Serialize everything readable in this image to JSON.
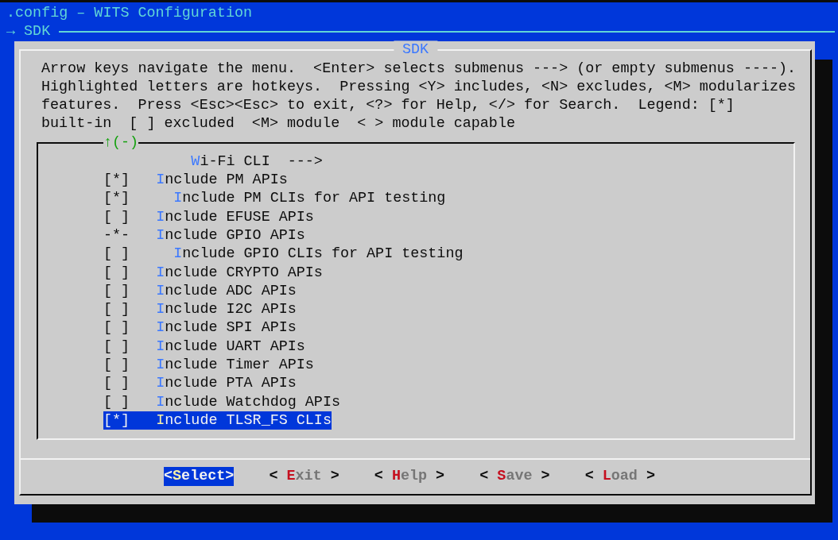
{
  "header": {
    "title": ".config – WITS Configuration",
    "breadcrumb": "→ SDK"
  },
  "dialog": {
    "title": "SDK",
    "help_text": "Arrow keys navigate the menu.  <Enter> selects submenus ---> (or empty submenus ----).\nHighlighted letters are hotkeys.  Pressing <Y> includes, <N> excludes, <M> modularizes\nfeatures.  Press <Esc><Esc> to exit, <?> for Help, </> for Search.  Legend: [*]\nbuilt-in  [ ] excluded  <M> module  < > module capable",
    "menu": {
      "scroll_indicator": "↑(-)",
      "items": [
        {
          "kind": "menu",
          "label": "Wi-Fi CLI",
          "suffix": "--->",
          "selected": false
        },
        {
          "kind": "option",
          "marker": "[*]",
          "label": "Include PM APIs",
          "selected": false,
          "children": [
            {
              "kind": "option",
              "marker": "[*]",
              "label": "Include PM CLIs for API testing",
              "selected": false
            }
          ]
        },
        {
          "kind": "option",
          "marker": "[ ]",
          "label": "Include EFUSE APIs",
          "selected": false
        },
        {
          "kind": "option",
          "marker": "-*-",
          "label": "Include GPIO APIs",
          "selected": false,
          "children": [
            {
              "kind": "option",
              "marker": "[ ]",
              "label": "Include GPIO CLIs for API testing",
              "selected": false
            }
          ]
        },
        {
          "kind": "option",
          "marker": "[ ]",
          "label": "Include CRYPTO APIs",
          "selected": false
        },
        {
          "kind": "option",
          "marker": "[ ]",
          "label": "Include ADC APIs",
          "selected": false
        },
        {
          "kind": "option",
          "marker": "[ ]",
          "label": "Include I2C APIs",
          "selected": false
        },
        {
          "kind": "option",
          "marker": "[ ]",
          "label": "Include SPI APIs",
          "selected": false
        },
        {
          "kind": "option",
          "marker": "[ ]",
          "label": "Include UART APIs",
          "selected": false
        },
        {
          "kind": "option",
          "marker": "[ ]",
          "label": "Include Timer APIs",
          "selected": false
        },
        {
          "kind": "option",
          "marker": "[ ]",
          "label": "Include PTA APIs",
          "selected": false
        },
        {
          "kind": "option",
          "marker": "[ ]",
          "label": "Include Watchdog APIs",
          "selected": false
        },
        {
          "kind": "option",
          "marker": "[*]",
          "label": "Include TLSR_FS CLIs",
          "selected": true
        }
      ]
    },
    "buttons": [
      {
        "open": "<",
        "label": "Select",
        "close": ">",
        "selected": true
      },
      {
        "open": "<",
        "label": "Exit",
        "close": ">",
        "selected": false
      },
      {
        "open": "<",
        "label": "Help",
        "close": ">",
        "selected": false
      },
      {
        "open": "<",
        "label": "Save",
        "close": ">",
        "selected": false
      },
      {
        "open": "<",
        "label": "Load",
        "close": ">",
        "selected": false
      }
    ]
  }
}
